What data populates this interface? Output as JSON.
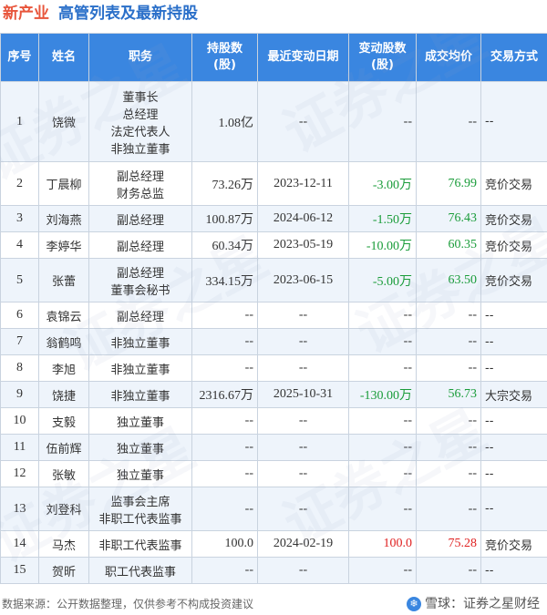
{
  "title": {
    "company": "新产业",
    "subtitle": "高管列表及最新持股"
  },
  "table": {
    "headers": [
      "序号",
      "姓名",
      "职务",
      "持股数\n(股)",
      "最近变动日期",
      "变动股数\n(股)",
      "成交均价",
      "交易方式"
    ],
    "rows": [
      {
        "no": "1",
        "name": "饶微",
        "title": "董事长\n总经理\n法定代表人\n非独立董事",
        "shares": "1.08亿",
        "date": "--",
        "change": "--",
        "price": "--",
        "method": "--",
        "dir": "none"
      },
      {
        "no": "2",
        "name": "丁晨柳",
        "title": "副总经理\n财务总监",
        "shares": "73.26万",
        "date": "2023-12-11",
        "change": "-3.00万",
        "price": "76.99",
        "method": "竞价交易",
        "dir": "neg"
      },
      {
        "no": "3",
        "name": "刘海燕",
        "title": "副总经理",
        "shares": "100.87万",
        "date": "2024-06-12",
        "change": "-1.50万",
        "price": "76.43",
        "method": "竞价交易",
        "dir": "neg"
      },
      {
        "no": "4",
        "name": "李婷华",
        "title": "副总经理",
        "shares": "60.34万",
        "date": "2023-05-19",
        "change": "-10.00万",
        "price": "60.35",
        "method": "竞价交易",
        "dir": "neg"
      },
      {
        "no": "5",
        "name": "张蕾",
        "title": "副总经理\n董事会秘书",
        "shares": "334.15万",
        "date": "2023-06-15",
        "change": "-5.00万",
        "price": "63.50",
        "method": "竞价交易",
        "dir": "neg"
      },
      {
        "no": "6",
        "name": "袁锦云",
        "title": "副总经理",
        "shares": "--",
        "date": "--",
        "change": "--",
        "price": "--",
        "method": "--",
        "dir": "none"
      },
      {
        "no": "7",
        "name": "翁鹤鸣",
        "title": "非独立董事",
        "shares": "--",
        "date": "--",
        "change": "--",
        "price": "--",
        "method": "--",
        "dir": "none"
      },
      {
        "no": "8",
        "name": "李旭",
        "title": "非独立董事",
        "shares": "--",
        "date": "--",
        "change": "--",
        "price": "--",
        "method": "--",
        "dir": "none"
      },
      {
        "no": "9",
        "name": "饶捷",
        "title": "非独立董事",
        "shares": "2316.67万",
        "date": "2025-10-31",
        "change": "-130.00万",
        "price": "56.73",
        "method": "大宗交易",
        "dir": "neg"
      },
      {
        "no": "10",
        "name": "支毅",
        "title": "独立董事",
        "shares": "--",
        "date": "--",
        "change": "--",
        "price": "--",
        "method": "--",
        "dir": "none"
      },
      {
        "no": "11",
        "name": "伍前辉",
        "title": "独立董事",
        "shares": "--",
        "date": "--",
        "change": "--",
        "price": "--",
        "method": "--",
        "dir": "none"
      },
      {
        "no": "12",
        "name": "张敏",
        "title": "独立董事",
        "shares": "--",
        "date": "--",
        "change": "--",
        "price": "--",
        "method": "--",
        "dir": "none"
      },
      {
        "no": "13",
        "name": "刘登科",
        "title": "监事会主席\n非职工代表监事",
        "shares": "--",
        "date": "--",
        "change": "--",
        "price": "--",
        "method": "--",
        "dir": "none"
      },
      {
        "no": "14",
        "name": "马杰",
        "title": "非职工代表监事",
        "shares": "100.0",
        "date": "2024-02-19",
        "change": "100.0",
        "price": "75.28",
        "method": "竞价交易",
        "dir": "pos"
      },
      {
        "no": "15",
        "name": "贺昕",
        "title": "职工代表监事",
        "shares": "--",
        "date": "--",
        "change": "--",
        "price": "--",
        "method": "--",
        "dir": "none"
      }
    ]
  },
  "footer": {
    "source": "数据来源：公开数据整理，仅供参考不构成投资建议",
    "brand": "雪球：证券之星财经"
  },
  "colors": {
    "header_bg": "#3a86e0",
    "company": "#e8553b",
    "subtitle": "#2a6fc9",
    "negative": "#1a9c3a",
    "positive": "#e02020"
  },
  "watermark": "证券之星"
}
